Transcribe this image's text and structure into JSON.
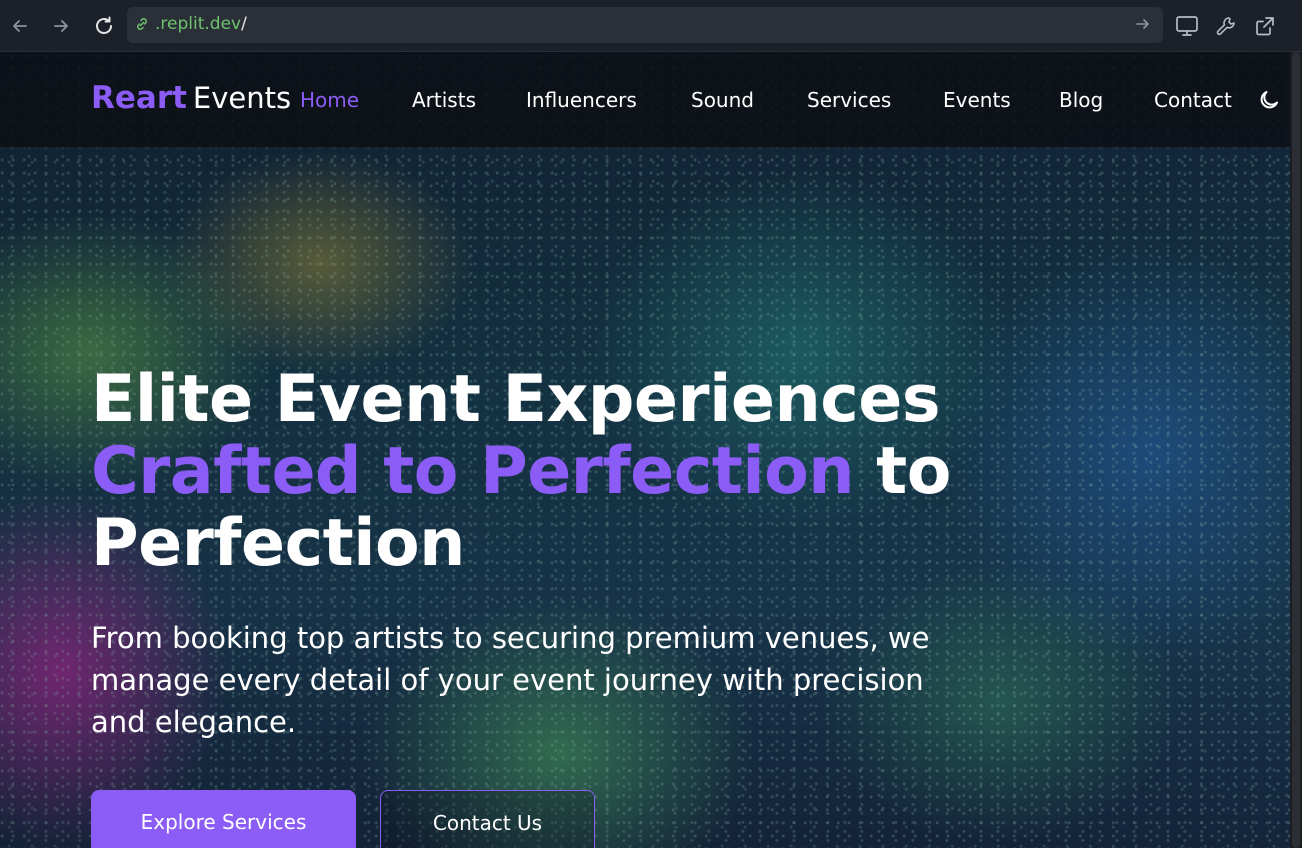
{
  "browser": {
    "url_host": ".replit.dev",
    "url_path": "/",
    "icons": [
      "back-arrow-icon",
      "forward-arrow-icon",
      "reload-icon",
      "link-icon",
      "go-arrow-icon",
      "monitor-icon",
      "wrench-icon",
      "external-link-icon"
    ]
  },
  "header": {
    "logo_brand": "Reart",
    "logo_sub": "Events",
    "nav": [
      {
        "label": "Home",
        "active": true
      },
      {
        "label": "Artists"
      },
      {
        "label": "Influencers"
      },
      {
        "label": "Sound"
      },
      {
        "label": "Services"
      },
      {
        "label": "Events"
      },
      {
        "label": "Blog"
      },
      {
        "label": "Contact"
      }
    ],
    "theme_icon": "moon-icon"
  },
  "hero": {
    "headline_line1": "Elite Event Experiences",
    "headline_accent": "Crafted to Perfection",
    "headline_tail": "to",
    "headline_line3": "Perfection",
    "subtext": "From booking top artists to securing premium venues, we manage every detail of your event journey with precision and elegance.",
    "primary_button": "Explore Services",
    "secondary_button": "Contact Us"
  },
  "colors": {
    "accent": "#8b5cf6",
    "url_text": "#6cc36c"
  }
}
